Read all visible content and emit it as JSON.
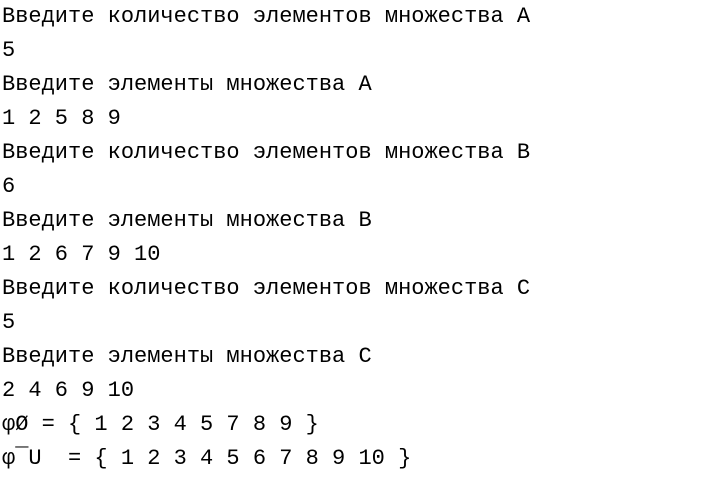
{
  "console": {
    "lines": [
      "Введите количество элементов множества A",
      "5",
      "Введите элементы множества A",
      "1 2 5 8 9",
      "Введите количество элементов множества B",
      "6",
      "Введите элементы множества B",
      "1 2 6 7 9 10",
      "Введите количество элементов множества C",
      "5",
      "Введите элементы множества C",
      "2 4 6 9 10",
      "φØ = { 1 2 3 4 5 7 8 9 }",
      "φ¯U  = { 1 2 3 4 5 6 7 8 9 10 }"
    ]
  }
}
